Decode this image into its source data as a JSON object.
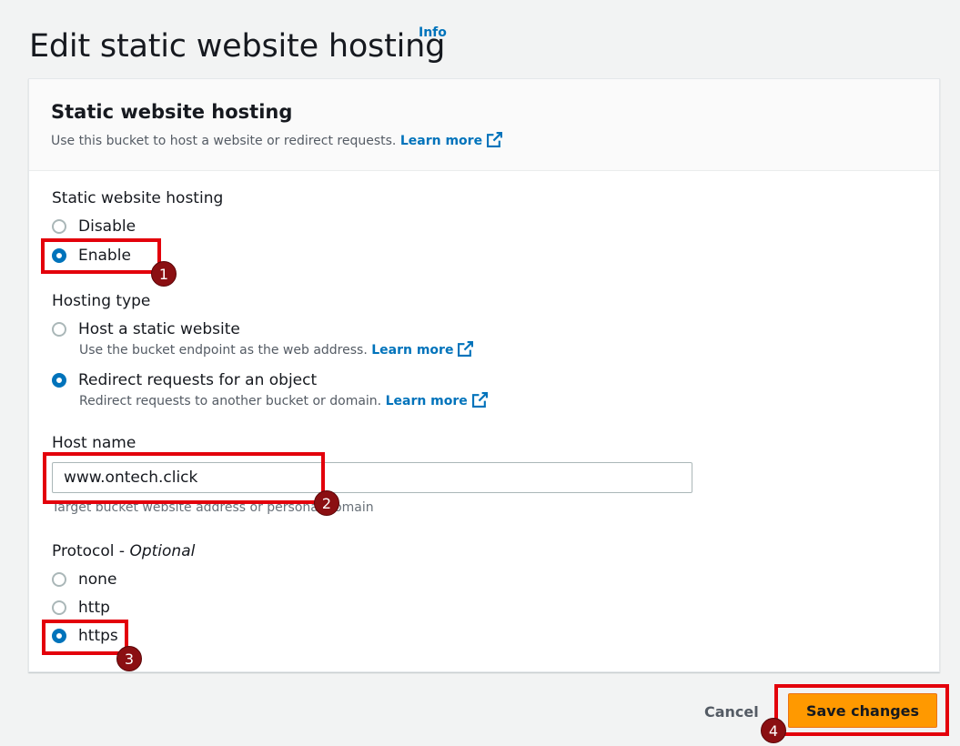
{
  "header": {
    "title": "Edit static website hosting",
    "info_link": "Info"
  },
  "panel": {
    "title": "Static website hosting",
    "description": "Use this bucket to host a website or redirect requests.",
    "learn_more": "Learn more"
  },
  "hosting": {
    "label": "Static website hosting",
    "options": [
      {
        "label": "Disable",
        "selected": false
      },
      {
        "label": "Enable",
        "selected": true
      }
    ]
  },
  "hosting_type": {
    "label": "Hosting type",
    "options": [
      {
        "label": "Host a static website",
        "description": "Use the bucket endpoint as the web address.",
        "learn_more": "Learn more",
        "selected": false
      },
      {
        "label": "Redirect requests for an object",
        "description": "Redirect requests to another bucket or domain.",
        "learn_more": "Learn more",
        "selected": true
      }
    ]
  },
  "host_name": {
    "label": "Host name",
    "value": "www.ontech.click",
    "constraint": "Target bucket website address or personal domain"
  },
  "protocol": {
    "label": "Protocol - ",
    "optional": "Optional",
    "options": [
      {
        "label": "none",
        "selected": false
      },
      {
        "label": "http",
        "selected": false
      },
      {
        "label": "https",
        "selected": true
      }
    ]
  },
  "footer": {
    "cancel_label": "Cancel",
    "save_label": "Save changes"
  },
  "annotations": {
    "badges": [
      "1",
      "2",
      "3",
      "4"
    ]
  },
  "colors": {
    "link": "#0073bb",
    "primary_button": "#ff9900",
    "highlight_box": "#e3000b",
    "badge": "#8b0f12"
  }
}
